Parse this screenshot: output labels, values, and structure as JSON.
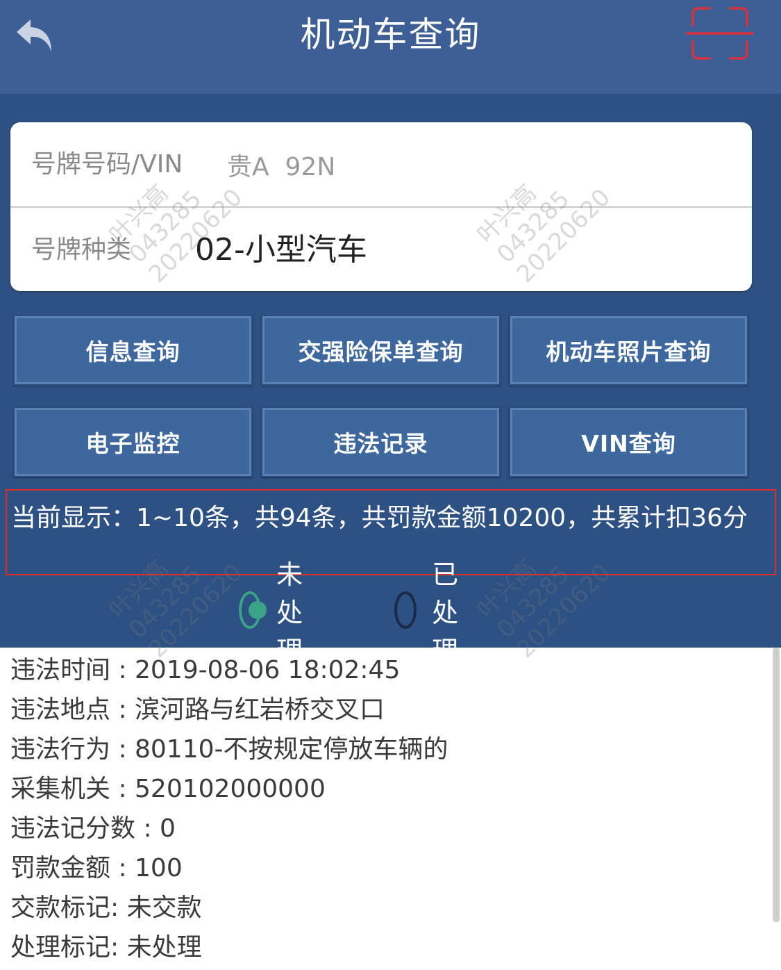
{
  "header": {
    "title": "机动车查询"
  },
  "form": {
    "plate_label": "号牌号码/VIN",
    "plate_value": "贵A  92N",
    "type_label": "号牌种类",
    "type_value": "02-小型汽车"
  },
  "buttons": {
    "info_query": "信息查询",
    "insurance_query": "交强险保单查询",
    "photo_query": "机动车照片查询",
    "monitoring": "电子监控",
    "violation_records": "违法记录",
    "vin_query": "VIN查询"
  },
  "summary": {
    "text": "当前显示：1~10条，共94条，共罚款金额10200，共累计扣36分"
  },
  "filter": {
    "unprocessed": "未处理",
    "processed": "已处理",
    "selected": "未处理"
  },
  "record": {
    "time": "违法时间 : 2019-08-06 18:02:45",
    "location": "违法地点 : 滨河路与红岩桥交叉口",
    "behavior": "违法行为 : 80110-不按规定停放车辆的",
    "agency": "采集机关 : 520102000000",
    "points": "违法记分数 : 0",
    "fine": "罚款金额 : 100",
    "payment": "交款标记:  未交款",
    "process": "处理标记:  未处理"
  },
  "watermark": {
    "name": "叶兴高",
    "id": "043285",
    "date": "20220620"
  },
  "colors": {
    "header_bg": "#3d5f95",
    "panel_bg": "#2e5184",
    "button_bg": "#3e679e",
    "highlight_border": "#e02b2b",
    "radio_selected": "#3aa487"
  }
}
